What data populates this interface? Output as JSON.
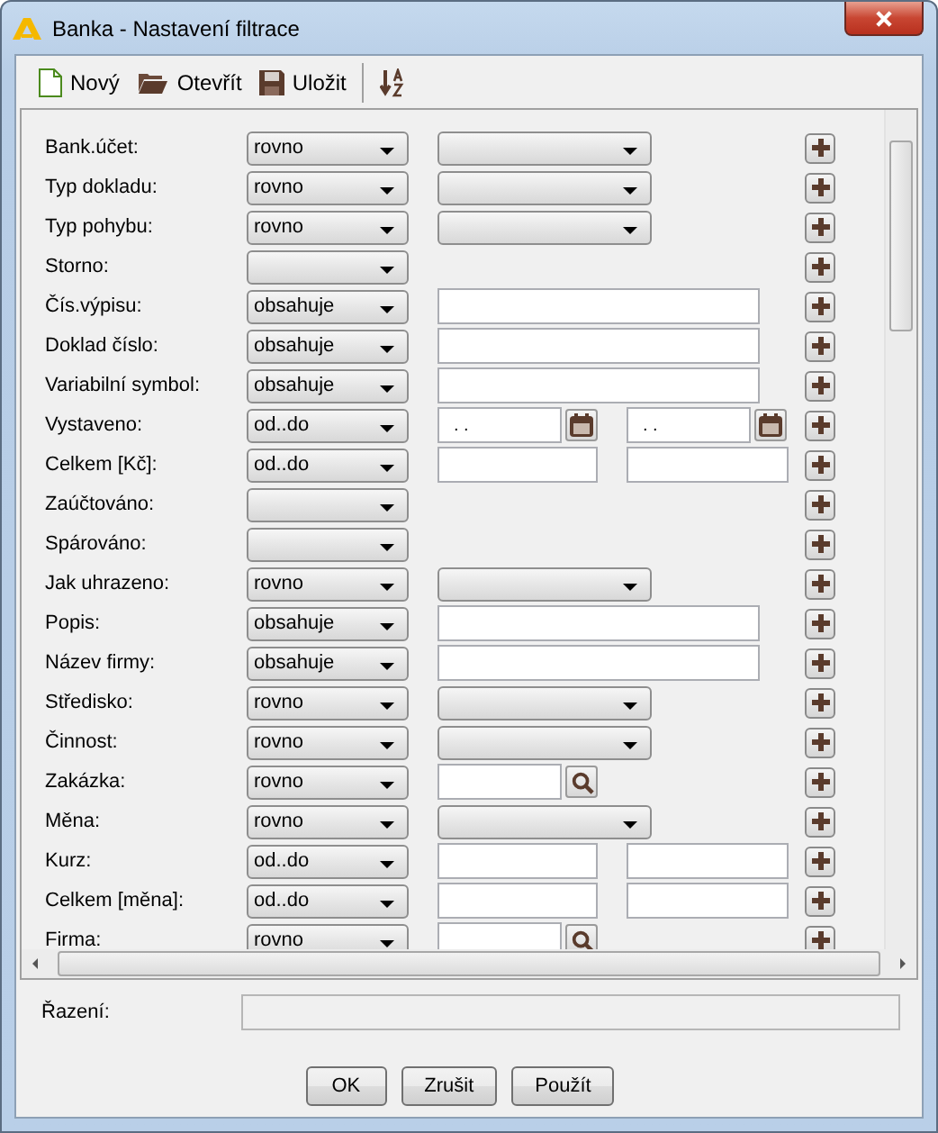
{
  "window": {
    "title": "Banka - Nastavení filtrace"
  },
  "toolbar": [
    {
      "kind": "new",
      "label": "Nový"
    },
    {
      "kind": "open",
      "label": "Otevřít"
    },
    {
      "kind": "save",
      "label": "Uložit"
    },
    {
      "kind": "sort"
    }
  ],
  "rows": [
    {
      "label": "Bank.účet:",
      "operator": "rovno",
      "value": {
        "kind": "combo"
      }
    },
    {
      "label": "Typ dokladu:",
      "operator": "rovno",
      "value": {
        "kind": "combo"
      }
    },
    {
      "label": "Typ pohybu:",
      "operator": "rovno",
      "value": {
        "kind": "combo"
      }
    },
    {
      "label": "Storno:",
      "value": {
        "kind": "none"
      }
    },
    {
      "label": "Čís.výpisu:",
      "operator": "obsahuje",
      "value": {
        "kind": "text"
      }
    },
    {
      "label": "Doklad číslo:",
      "operator": "obsahuje",
      "value": {
        "kind": "text"
      }
    },
    {
      "label": "Variabilní symbol:",
      "operator": "obsahuje",
      "value": {
        "kind": "text"
      }
    },
    {
      "label": "Vystaveno:",
      "operator": "od..do",
      "value": {
        "kind": "dates",
        "from": ". .",
        "to": ". ."
      }
    },
    {
      "label": "Celkem [Kč]:",
      "operator": "od..do",
      "value": {
        "kind": "range"
      }
    },
    {
      "label": "Zaúčtováno:",
      "value": {
        "kind": "none"
      }
    },
    {
      "label": "Spárováno:",
      "value": {
        "kind": "none"
      }
    },
    {
      "label": "Jak uhrazeno:",
      "operator": "rovno",
      "value": {
        "kind": "combo"
      }
    },
    {
      "label": "Popis:",
      "operator": "obsahuje",
      "value": {
        "kind": "text"
      }
    },
    {
      "label": "Název firmy:",
      "operator": "obsahuje",
      "value": {
        "kind": "text"
      }
    },
    {
      "label": "Středisko:",
      "operator": "rovno",
      "value": {
        "kind": "combo"
      }
    },
    {
      "label": "Činnost:",
      "operator": "rovno",
      "value": {
        "kind": "combo"
      }
    },
    {
      "label": "Zakázka:",
      "operator": "rovno",
      "value": {
        "kind": "lookup"
      }
    },
    {
      "label": "Měna:",
      "operator": "rovno",
      "value": {
        "kind": "combo"
      }
    },
    {
      "label": "Kurz:",
      "operator": "od..do",
      "value": {
        "kind": "range"
      }
    },
    {
      "label": "Celkem [měna]:",
      "operator": "od..do",
      "value": {
        "kind": "range"
      }
    },
    {
      "label": "Firma:",
      "operator": "rovno",
      "value": {
        "kind": "lookup"
      }
    }
  ],
  "sorting": {
    "label": "Řazení:"
  },
  "buttons": [
    "OK",
    "Zrušit",
    "Použít"
  ]
}
